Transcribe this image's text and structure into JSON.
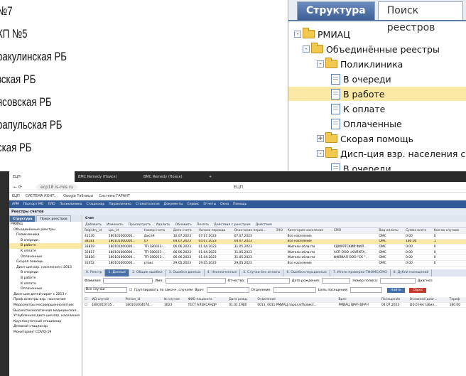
{
  "background_list": [
    "№7",
    "КП №5",
    "ракулинская РБ",
    "зская РБ",
    "ясовская РБ",
    "рапульская РБ",
    "ская РБ"
  ],
  "zoom_panel": {
    "tabs": [
      "Структура",
      "Поиск реестров"
    ],
    "tree": [
      {
        "label": "РМИАЦ",
        "type": "folder",
        "level": 0,
        "exp": "-"
      },
      {
        "label": "Объединённые реестры",
        "type": "folder",
        "level": 1,
        "exp": "-"
      },
      {
        "label": "Поликлиника",
        "type": "folder",
        "level": 2,
        "exp": "-"
      },
      {
        "label": "В очереди",
        "type": "doc",
        "level": 3
      },
      {
        "label": "В работе",
        "type": "doc",
        "level": 3,
        "selected": true
      },
      {
        "label": "К оплате",
        "type": "doc",
        "level": 3
      },
      {
        "label": "Оплаченные",
        "type": "doc",
        "level": 3
      },
      {
        "label": "Скорая помощь",
        "type": "folder",
        "level": 2,
        "exp": "+"
      },
      {
        "label": "Дисп-ция взр. населения с 2013",
        "type": "folder",
        "level": 2,
        "exp": "-"
      },
      {
        "label": "В очереди",
        "type": "doc",
        "level": 3
      },
      {
        "label": "В работе",
        "type": "doc",
        "level": 3
      },
      {
        "label": "К оплате",
        "type": "doc",
        "level": 3
      }
    ]
  },
  "browser": {
    "tabs": [
      "ЕЦП",
      "BMC Remedy (Поиск)",
      "BMC Remedy (Поиск)"
    ],
    "window_title": "ЕЦП",
    "url": "ecp18.is-mis.ru",
    "bookmarks": [
      "ЕЦП",
      "СИСТЕМА КОНТ...",
      "Google Таблицы",
      "Система ГАРАНТ"
    ],
    "app_menu": [
      "АРМ",
      "Паспорт МО",
      "ЛЛО",
      "Поликлиника",
      "Стационар",
      "Параклиника",
      "Стоматология",
      "Документы",
      "Сервис",
      "Отчеты",
      "Окна",
      "Помощь"
    ],
    "section_title": "Реестры счетов",
    "sidebar_tabs": [
      "Структура",
      "Поиск реестров"
    ],
    "sidebar_tree": [
      {
        "label": "РМИАЦ"
      },
      {
        "label": "Объединённые реестры"
      },
      {
        "label": "Поликлиника"
      },
      {
        "label": "В очереди"
      },
      {
        "label": "В работе",
        "selected": true
      },
      {
        "label": "К оплате"
      },
      {
        "label": "Оплаченные"
      },
      {
        "label": "Скорая помощь"
      },
      {
        "label": "Дисп-ция взр. населения с 2013"
      },
      {
        "label": "В очереди"
      },
      {
        "label": "В работе"
      },
      {
        "label": "К оплате"
      },
      {
        "label": "Оплаченные"
      },
      {
        "label": "Дисп-ция детей-сирот с 2013 г."
      },
      {
        "label": "Проф.осмотры взр. населения"
      },
      {
        "label": "Медосмотры несовершеннолетних"
      },
      {
        "label": "Высокотехнологичная медицинская..."
      },
      {
        "label": "Углубленная дисп-ция взр. населения"
      },
      {
        "label": "Круглосуточный стационар"
      },
      {
        "label": "Дневной стационар"
      },
      {
        "label": "Мониторинг COVID-19"
      }
    ],
    "main_title": "Счет",
    "toolbar": [
      "Добавить",
      "Изменить",
      "Просмотреть",
      "Удалить",
      "Обновить",
      "Печать",
      "Действия с реестром",
      "Действия"
    ],
    "table_headers": [
      "Registry_id",
      "Lpu_id",
      "Номер счета",
      "Дата счета",
      "Начало периода",
      "Окончание перио...",
      "ЗНО",
      "Категория населения",
      "СМО",
      "Вид оплаты",
      "Сумма всего",
      "Кол-во случаев"
    ],
    "rows": [
      [
        "41230",
        "180101000000...",
        "ДиспК",
        "10.07.2023",
        "07.07.2023",
        "07.07.2023",
        "",
        "Все население",
        "",
        "ОМС",
        "0.00",
        "0"
      ],
      [
        "38181",
        "180101000000...",
        "07",
        "04.07.2023",
        "04.07.2023",
        "04.07.2023",
        "",
        "Все население",
        "",
        "ОМС",
        "180.00",
        "1"
      ],
      [
        "33819",
        "180101000000...",
        "ТП-180023-...",
        "06.06.2023",
        "01.04.2023",
        "31.05.2023",
        "",
        "Жители области",
        "УДМУРТСКИЙ ФИЛ...",
        "ОМС",
        "0.00",
        "0"
      ],
      [
        "32817",
        "180101000000...",
        "ТП-180023-...",
        "06.06.2023",
        "01.04.2023",
        "31.05.2023",
        "",
        "Жители области",
        "АСП ООО «КАПИТА...",
        "ОМС",
        "0.00",
        "0"
      ],
      [
        "32816",
        "180101000000...",
        "ТП-180023-...",
        "06.06.2023",
        "01.04.2023",
        "31.05.2023",
        "",
        "Жители области",
        "ФИЛИАЛ ООО \"СК \"...",
        "ОМС",
        "0.00",
        "0"
      ],
      [
        "31052",
        "180101000000...",
        "ртвкс",
        "29.05.2023",
        "29.05.2023",
        "29.05.2023",
        "",
        "Все население",
        "",
        "ОМС",
        "0.00",
        "0"
      ]
    ],
    "bottom_tabs": [
      "0. Реестр",
      "1. Данные",
      "2. Общие ошибки",
      "3. Ошибки данных",
      "4. Неоплаченные",
      "5. Случаи без оплаты",
      "6. Ошибки персданных",
      "7. Итоги проверки ТФОМС/СМО",
      "8. Дубли посещений"
    ],
    "filters": {
      "surname": "Фамилия:",
      "name": "Имя:",
      "patronymic": "Отчество:",
      "birthdate": "Дата рождения:",
      "policy": "Номер полиса:",
      "diag": "Диагноз:",
      "all_cases": "Все случаи",
      "group": "Группировать по законч. случаям",
      "doctor": "Врач:",
      "department": "Отделение:",
      "purpose": "Цель посещения:",
      "search": "Найти",
      "reset": "Сброс"
    },
    "detail_headers": [
      "ИД случая",
      "Person_id",
      "№ случая",
      "ФИО пациента",
      "Дата рожд.",
      "Отделение",
      "Врач",
      "Посещение",
      "Основной диаг...",
      "Тариф"
    ],
    "detail_row": [
      "1801010735...",
      "180101004074...",
      "3023",
      "ТЕСТ АЛЕКСАНДР",
      "01.01.1980",
      "0011. 0011 РМИАЦ паралл/Поликл...",
      "РМИАЦ ВРАЧ ВРАЧ",
      "04.07.2023",
      "I20.0 Нестабил...",
      "180.00"
    ]
  }
}
